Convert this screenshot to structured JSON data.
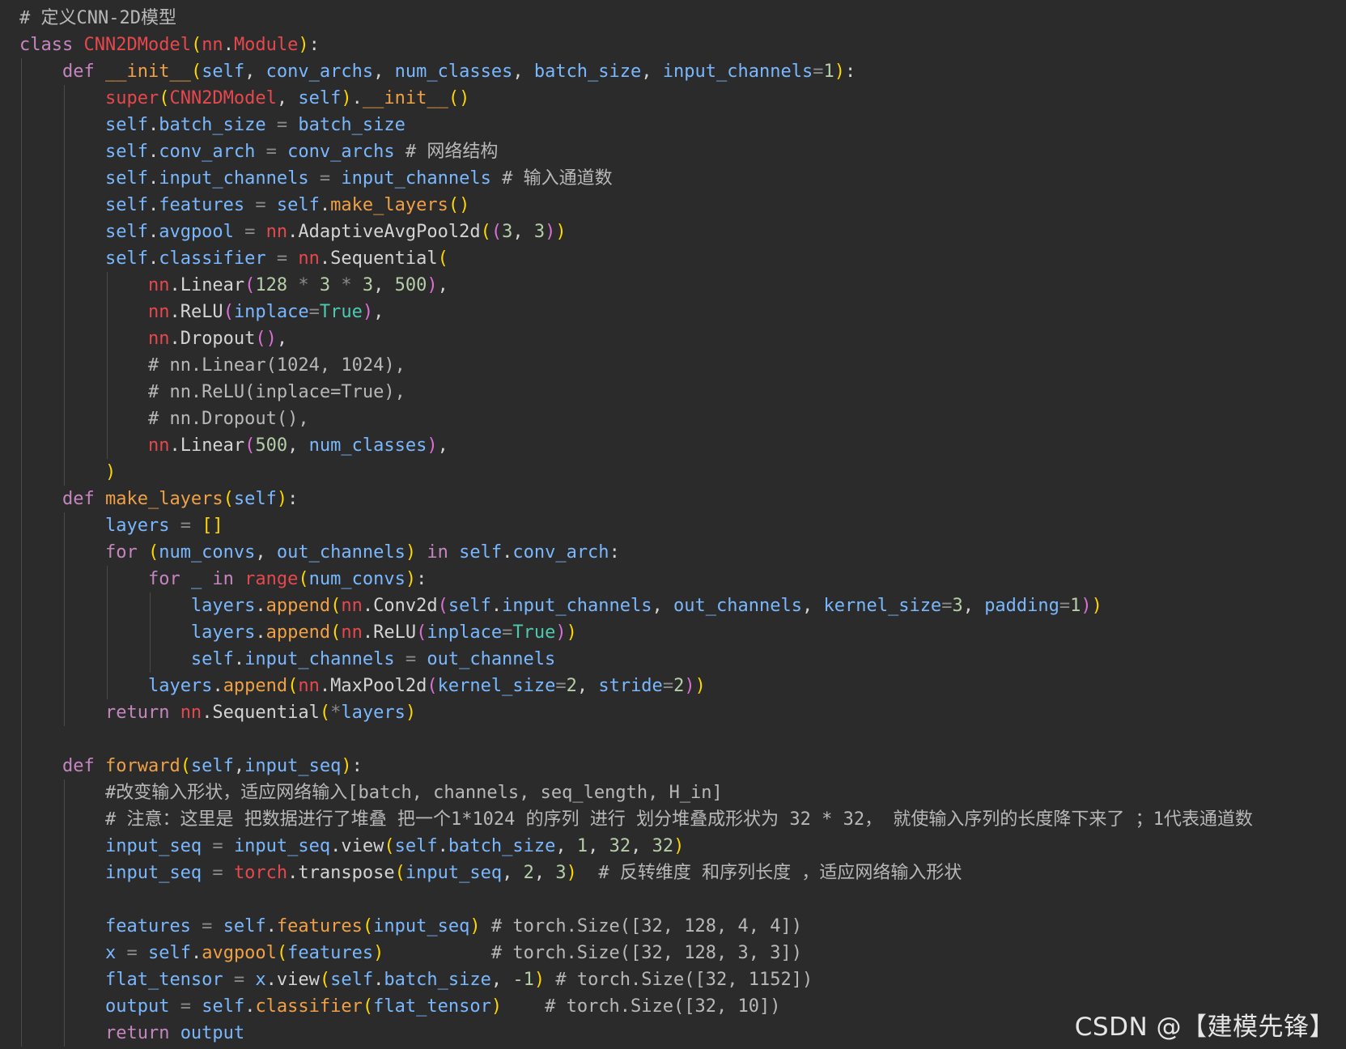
{
  "colors": {
    "background": "#2b2b2b",
    "default": "#d4d4d4",
    "keyword": "#c586c0",
    "class_name": "#e5484d",
    "function": "#f0a045",
    "variable": "#79b8ff",
    "number": "#b5cea8",
    "boolean": "#4ec9b0",
    "comment": "#b8b8b8",
    "operator": "#8a8a8a",
    "bracket1": "#ffd700",
    "bracket2": "#da70d6",
    "bracket3": "#179fff"
  },
  "watermark": "CSDN @【建模先锋】",
  "code_lines": [
    {
      "indent": 0,
      "tokens": [
        [
          "comment",
          "# 定义CNN-2D模型"
        ]
      ]
    },
    {
      "indent": 0,
      "tokens": [
        [
          "keyword",
          "class "
        ],
        [
          "class_name",
          "CNN2DModel"
        ],
        [
          "bracket1",
          "("
        ],
        [
          "class_name",
          "nn"
        ],
        [
          "default",
          "."
        ],
        [
          "class_name",
          "Module"
        ],
        [
          "bracket1",
          ")"
        ],
        [
          "default",
          ":"
        ]
      ]
    },
    {
      "indent": 1,
      "tokens": [
        [
          "keyword",
          "def "
        ],
        [
          "function",
          "__init__"
        ],
        [
          "bracket1",
          "("
        ],
        [
          "variable",
          "self"
        ],
        [
          "default",
          ", "
        ],
        [
          "variable",
          "conv_archs"
        ],
        [
          "default",
          ", "
        ],
        [
          "variable",
          "num_classes"
        ],
        [
          "default",
          ", "
        ],
        [
          "variable",
          "batch_size"
        ],
        [
          "default",
          ", "
        ],
        [
          "variable",
          "input_channels"
        ],
        [
          "operator",
          "="
        ],
        [
          "number",
          "1"
        ],
        [
          "bracket1",
          ")"
        ],
        [
          "default",
          ":"
        ]
      ]
    },
    {
      "indent": 2,
      "tokens": [
        [
          "class_name",
          "super"
        ],
        [
          "bracket1",
          "("
        ],
        [
          "class_name",
          "CNN2DModel"
        ],
        [
          "default",
          ", "
        ],
        [
          "variable",
          "self"
        ],
        [
          "bracket1",
          ")"
        ],
        [
          "default",
          "."
        ],
        [
          "function",
          "__init__"
        ],
        [
          "bracket1",
          "()"
        ]
      ]
    },
    {
      "indent": 2,
      "tokens": [
        [
          "variable",
          "self"
        ],
        [
          "default",
          "."
        ],
        [
          "variable",
          "batch_size"
        ],
        [
          "operator",
          " = "
        ],
        [
          "variable",
          "batch_size"
        ]
      ]
    },
    {
      "indent": 2,
      "tokens": [
        [
          "variable",
          "self"
        ],
        [
          "default",
          "."
        ],
        [
          "variable",
          "conv_arch"
        ],
        [
          "operator",
          " = "
        ],
        [
          "variable",
          "conv_archs"
        ],
        [
          "comment",
          " # 网络结构"
        ]
      ]
    },
    {
      "indent": 2,
      "tokens": [
        [
          "variable",
          "self"
        ],
        [
          "default",
          "."
        ],
        [
          "variable",
          "input_channels"
        ],
        [
          "operator",
          " = "
        ],
        [
          "variable",
          "input_channels"
        ],
        [
          "comment",
          " # 输入通道数"
        ]
      ]
    },
    {
      "indent": 2,
      "tokens": [
        [
          "variable",
          "self"
        ],
        [
          "default",
          "."
        ],
        [
          "variable",
          "features"
        ],
        [
          "operator",
          " = "
        ],
        [
          "variable",
          "self"
        ],
        [
          "default",
          "."
        ],
        [
          "function",
          "make_layers"
        ],
        [
          "bracket1",
          "()"
        ]
      ]
    },
    {
      "indent": 2,
      "tokens": [
        [
          "variable",
          "self"
        ],
        [
          "default",
          "."
        ],
        [
          "variable",
          "avgpool"
        ],
        [
          "operator",
          " = "
        ],
        [
          "class_name",
          "nn"
        ],
        [
          "default",
          ".AdaptiveAvgPool2d"
        ],
        [
          "bracket1",
          "("
        ],
        [
          "bracket2",
          "("
        ],
        [
          "number",
          "3"
        ],
        [
          "default",
          ", "
        ],
        [
          "number",
          "3"
        ],
        [
          "bracket2",
          ")"
        ],
        [
          "bracket1",
          ")"
        ]
      ]
    },
    {
      "indent": 2,
      "tokens": [
        [
          "variable",
          "self"
        ],
        [
          "default",
          "."
        ],
        [
          "variable",
          "classifier"
        ],
        [
          "operator",
          " = "
        ],
        [
          "class_name",
          "nn"
        ],
        [
          "default",
          ".Sequential"
        ],
        [
          "bracket1",
          "("
        ]
      ]
    },
    {
      "indent": 3,
      "tokens": [
        [
          "class_name",
          "nn"
        ],
        [
          "default",
          ".Linear"
        ],
        [
          "bracket2",
          "("
        ],
        [
          "number",
          "128"
        ],
        [
          "operator",
          " * "
        ],
        [
          "number",
          "3"
        ],
        [
          "operator",
          " * "
        ],
        [
          "number",
          "3"
        ],
        [
          "default",
          ", "
        ],
        [
          "number",
          "500"
        ],
        [
          "bracket2",
          ")"
        ],
        [
          "default",
          ","
        ]
      ]
    },
    {
      "indent": 3,
      "tokens": [
        [
          "class_name",
          "nn"
        ],
        [
          "default",
          ".ReLU"
        ],
        [
          "bracket2",
          "("
        ],
        [
          "variable",
          "inplace"
        ],
        [
          "operator",
          "="
        ],
        [
          "boolean",
          "True"
        ],
        [
          "bracket2",
          ")"
        ],
        [
          "default",
          ","
        ]
      ]
    },
    {
      "indent": 3,
      "tokens": [
        [
          "class_name",
          "nn"
        ],
        [
          "default",
          ".Dropout"
        ],
        [
          "bracket2",
          "()"
        ],
        [
          "default",
          ","
        ]
      ]
    },
    {
      "indent": 3,
      "tokens": [
        [
          "comment",
          "# nn.Linear(1024, 1024),"
        ]
      ]
    },
    {
      "indent": 3,
      "tokens": [
        [
          "comment",
          "# nn.ReLU(inplace=True),"
        ]
      ]
    },
    {
      "indent": 3,
      "tokens": [
        [
          "comment",
          "# nn.Dropout(),"
        ]
      ]
    },
    {
      "indent": 3,
      "tokens": [
        [
          "class_name",
          "nn"
        ],
        [
          "default",
          ".Linear"
        ],
        [
          "bracket2",
          "("
        ],
        [
          "number",
          "500"
        ],
        [
          "default",
          ", "
        ],
        [
          "variable",
          "num_classes"
        ],
        [
          "bracket2",
          ")"
        ],
        [
          "default",
          ","
        ]
      ]
    },
    {
      "indent": 2,
      "tokens": [
        [
          "bracket1",
          ")"
        ]
      ]
    },
    {
      "indent": 1,
      "tokens": [
        [
          "keyword",
          "def "
        ],
        [
          "function",
          "make_layers"
        ],
        [
          "bracket1",
          "("
        ],
        [
          "variable",
          "self"
        ],
        [
          "bracket1",
          ")"
        ],
        [
          "default",
          ":"
        ]
      ]
    },
    {
      "indent": 2,
      "tokens": [
        [
          "variable",
          "layers"
        ],
        [
          "operator",
          " = "
        ],
        [
          "bracket1",
          "[]"
        ]
      ]
    },
    {
      "indent": 2,
      "tokens": [
        [
          "keyword",
          "for "
        ],
        [
          "bracket1",
          "("
        ],
        [
          "variable",
          "num_convs"
        ],
        [
          "default",
          ", "
        ],
        [
          "variable",
          "out_channels"
        ],
        [
          "bracket1",
          ")"
        ],
        [
          "keyword",
          " in "
        ],
        [
          "variable",
          "self"
        ],
        [
          "default",
          "."
        ],
        [
          "variable",
          "conv_arch"
        ],
        [
          "default",
          ":"
        ]
      ]
    },
    {
      "indent": 3,
      "tokens": [
        [
          "keyword",
          "for "
        ],
        [
          "variable",
          "_"
        ],
        [
          "keyword",
          " in "
        ],
        [
          "class_name",
          "range"
        ],
        [
          "bracket1",
          "("
        ],
        [
          "variable",
          "num_convs"
        ],
        [
          "bracket1",
          ")"
        ],
        [
          "default",
          ":"
        ]
      ]
    },
    {
      "indent": 4,
      "tokens": [
        [
          "variable",
          "layers"
        ],
        [
          "default",
          "."
        ],
        [
          "function",
          "append"
        ],
        [
          "bracket1",
          "("
        ],
        [
          "class_name",
          "nn"
        ],
        [
          "default",
          ".Conv2d"
        ],
        [
          "bracket2",
          "("
        ],
        [
          "variable",
          "self"
        ],
        [
          "default",
          "."
        ],
        [
          "variable",
          "input_channels"
        ],
        [
          "default",
          ", "
        ],
        [
          "variable",
          "out_channels"
        ],
        [
          "default",
          ", "
        ],
        [
          "variable",
          "kernel_size"
        ],
        [
          "operator",
          "="
        ],
        [
          "number",
          "3"
        ],
        [
          "default",
          ", "
        ],
        [
          "variable",
          "padding"
        ],
        [
          "operator",
          "="
        ],
        [
          "number",
          "1"
        ],
        [
          "bracket2",
          ")"
        ],
        [
          "bracket1",
          ")"
        ]
      ]
    },
    {
      "indent": 4,
      "tokens": [
        [
          "variable",
          "layers"
        ],
        [
          "default",
          "."
        ],
        [
          "function",
          "append"
        ],
        [
          "bracket1",
          "("
        ],
        [
          "class_name",
          "nn"
        ],
        [
          "default",
          ".ReLU"
        ],
        [
          "bracket2",
          "("
        ],
        [
          "variable",
          "inplace"
        ],
        [
          "operator",
          "="
        ],
        [
          "boolean",
          "True"
        ],
        [
          "bracket2",
          ")"
        ],
        [
          "bracket1",
          ")"
        ]
      ]
    },
    {
      "indent": 4,
      "tokens": [
        [
          "variable",
          "self"
        ],
        [
          "default",
          "."
        ],
        [
          "variable",
          "input_channels"
        ],
        [
          "operator",
          " = "
        ],
        [
          "variable",
          "out_channels"
        ]
      ]
    },
    {
      "indent": 3,
      "tokens": [
        [
          "variable",
          "layers"
        ],
        [
          "default",
          "."
        ],
        [
          "function",
          "append"
        ],
        [
          "bracket1",
          "("
        ],
        [
          "class_name",
          "nn"
        ],
        [
          "default",
          ".MaxPool2d"
        ],
        [
          "bracket2",
          "("
        ],
        [
          "variable",
          "kernel_size"
        ],
        [
          "operator",
          "="
        ],
        [
          "number",
          "2"
        ],
        [
          "default",
          ", "
        ],
        [
          "variable",
          "stride"
        ],
        [
          "operator",
          "="
        ],
        [
          "number",
          "2"
        ],
        [
          "bracket2",
          ")"
        ],
        [
          "bracket1",
          ")"
        ]
      ]
    },
    {
      "indent": 2,
      "tokens": [
        [
          "keyword",
          "return "
        ],
        [
          "class_name",
          "nn"
        ],
        [
          "default",
          ".Sequential"
        ],
        [
          "bracket1",
          "("
        ],
        [
          "operator",
          "*"
        ],
        [
          "variable",
          "layers"
        ],
        [
          "bracket1",
          ")"
        ]
      ]
    },
    {
      "indent": 1,
      "tokens": []
    },
    {
      "indent": 1,
      "tokens": [
        [
          "keyword",
          "def "
        ],
        [
          "function",
          "forward"
        ],
        [
          "bracket1",
          "("
        ],
        [
          "variable",
          "self"
        ],
        [
          "default",
          ","
        ],
        [
          "variable",
          "input_seq"
        ],
        [
          "bracket1",
          ")"
        ],
        [
          "default",
          ":"
        ]
      ]
    },
    {
      "indent": 2,
      "tokens": [
        [
          "comment",
          "#改变输入形状，适应网络输入[batch, channels, seq_length, H_in]"
        ]
      ]
    },
    {
      "indent": 2,
      "tokens": [
        [
          "comment",
          "# 注意：这里是 把数据进行了堆叠 把一个1*1024 的序列 进行 划分堆叠成形状为 32 * 32， 就使输入序列的长度降下来了 ；1代表通道数"
        ]
      ]
    },
    {
      "indent": 2,
      "tokens": [
        [
          "variable",
          "input_seq"
        ],
        [
          "operator",
          " = "
        ],
        [
          "variable",
          "input_seq"
        ],
        [
          "default",
          ".view"
        ],
        [
          "bracket1",
          "("
        ],
        [
          "variable",
          "self"
        ],
        [
          "default",
          "."
        ],
        [
          "variable",
          "batch_size"
        ],
        [
          "default",
          ", "
        ],
        [
          "number",
          "1"
        ],
        [
          "default",
          ", "
        ],
        [
          "number",
          "32"
        ],
        [
          "default",
          ", "
        ],
        [
          "number",
          "32"
        ],
        [
          "bracket1",
          ")"
        ]
      ]
    },
    {
      "indent": 2,
      "tokens": [
        [
          "variable",
          "input_seq"
        ],
        [
          "operator",
          " = "
        ],
        [
          "class_name",
          "torch"
        ],
        [
          "default",
          ".transpose"
        ],
        [
          "bracket1",
          "("
        ],
        [
          "variable",
          "input_seq"
        ],
        [
          "default",
          ", "
        ],
        [
          "number",
          "2"
        ],
        [
          "default",
          ", "
        ],
        [
          "number",
          "3"
        ],
        [
          "bracket1",
          ")"
        ],
        [
          "comment",
          "  # 反转维度 和序列长度 ，适应网络输入形状"
        ]
      ]
    },
    {
      "indent": 2,
      "tokens": []
    },
    {
      "indent": 2,
      "tokens": [
        [
          "variable",
          "features"
        ],
        [
          "operator",
          " = "
        ],
        [
          "variable",
          "self"
        ],
        [
          "default",
          "."
        ],
        [
          "function",
          "features"
        ],
        [
          "bracket1",
          "("
        ],
        [
          "variable",
          "input_seq"
        ],
        [
          "bracket1",
          ")"
        ],
        [
          "comment",
          " # torch.Size([32, 128, 4, 4])"
        ]
      ]
    },
    {
      "indent": 2,
      "tokens": [
        [
          "variable",
          "x"
        ],
        [
          "operator",
          " = "
        ],
        [
          "variable",
          "self"
        ],
        [
          "default",
          "."
        ],
        [
          "function",
          "avgpool"
        ],
        [
          "bracket1",
          "("
        ],
        [
          "variable",
          "features"
        ],
        [
          "bracket1",
          ")"
        ],
        [
          "default",
          "          "
        ],
        [
          "comment",
          "# torch.Size([32, 128, 3, 3])"
        ]
      ]
    },
    {
      "indent": 2,
      "tokens": [
        [
          "variable",
          "flat_tensor"
        ],
        [
          "operator",
          " = "
        ],
        [
          "variable",
          "x"
        ],
        [
          "default",
          ".view"
        ],
        [
          "bracket1",
          "("
        ],
        [
          "variable",
          "self"
        ],
        [
          "default",
          "."
        ],
        [
          "variable",
          "batch_size"
        ],
        [
          "default",
          ", "
        ],
        [
          "number",
          "-1"
        ],
        [
          "bracket1",
          ")"
        ],
        [
          "comment",
          " # torch.Size([32, 1152])"
        ]
      ]
    },
    {
      "indent": 2,
      "tokens": [
        [
          "variable",
          "output"
        ],
        [
          "operator",
          " = "
        ],
        [
          "variable",
          "self"
        ],
        [
          "default",
          "."
        ],
        [
          "function",
          "classifier"
        ],
        [
          "bracket1",
          "("
        ],
        [
          "variable",
          "flat_tensor"
        ],
        [
          "bracket1",
          ")"
        ],
        [
          "default",
          "    "
        ],
        [
          "comment",
          "# torch.Size([32, 10])"
        ]
      ]
    },
    {
      "indent": 2,
      "tokens": [
        [
          "keyword",
          "return "
        ],
        [
          "variable",
          "output"
        ]
      ]
    }
  ]
}
